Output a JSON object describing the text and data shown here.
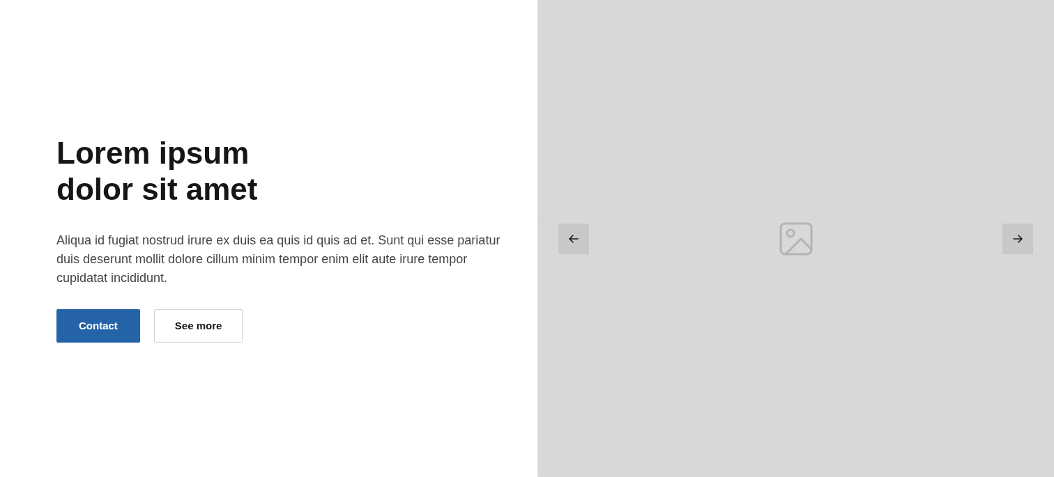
{
  "hero": {
    "heading": "Lorem ipsum\ndolor sit amet",
    "body": "Aliqua id fugiat nostrud irure ex duis ea quis id quis ad et. Sunt qui esse pariatur duis deserunt mollit dolore cillum minim tempor enim elit aute irure tempor cupidatat incididunt.",
    "buttons": [
      {
        "label": "Contact",
        "kind": "primary"
      },
      {
        "label": "See more",
        "kind": "secondary"
      }
    ]
  },
  "gallery": {
    "kind": "placeholder"
  }
}
